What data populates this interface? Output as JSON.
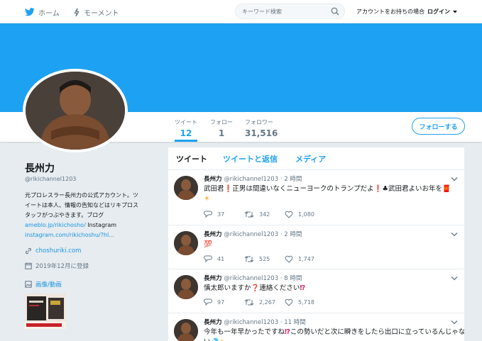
{
  "nav": {
    "home": "ホーム",
    "moments": "モーメント",
    "search_placeholder": "キーワード検索",
    "login_prompt": "アカウントをお持ちの場合",
    "login": "ログイン"
  },
  "colors": {
    "accent": "#1da1f2",
    "banner": "#1da1f2",
    "link": "#1b95e0",
    "background": "#e6ecf0"
  },
  "profile": {
    "name": "長州力",
    "handle": "@rikichannel1203",
    "bio_lines": [
      "元プロレスラー長州力の公式アカウント。ツ",
      "イートは本人、情報の告知などはリキプロス",
      "タッフがつぶやきます。ブログ"
    ],
    "blog_link": "ameblo.jp/rikichosho/",
    "instagram_label": " Instagram",
    "instagram_link": "instagram.com/rikichoshu/?hl...",
    "website": "choshuriki.com",
    "joined": "2019年12月に登録",
    "media_label": "画像/動画"
  },
  "stats": [
    {
      "label": "ツイート",
      "value": "12"
    },
    {
      "label": "フォロー",
      "value": "1"
    },
    {
      "label": "フォロワー",
      "value": "31,516"
    }
  ],
  "follow_button": "フォローする",
  "timeline": {
    "tabs": [
      "ツイート",
      "ツイートと返信",
      "メディア"
    ],
    "tweets": [
      {
        "name": "長州力",
        "handle": "@rikichannel1203",
        "time": "· 2 時間",
        "text_parts": [
          "武田君",
          "❗",
          "正男は間違いなくニューヨークのトランプだよ",
          "❗",
          "♣",
          "武田君よいお年を",
          "🧧",
          "☀"
        ],
        "replies": "37",
        "retweets": "342",
        "likes": "1,080"
      },
      {
        "name": "長州力",
        "handle": "@rikichannel1203",
        "time": "· 2 時間",
        "text": "💯",
        "replies": "41",
        "retweets": "525",
        "likes": "1,747"
      },
      {
        "name": "長州力",
        "handle": "@rikichannel1203",
        "time": "· 8 時間",
        "text_parts": [
          "慎太郎いますか",
          "❓",
          "連絡ください",
          "⁉"
        ],
        "replies": "97",
        "retweets": "2,267",
        "likes": "5,718"
      },
      {
        "name": "長州力",
        "handle": "@rikichannel1203",
        "time": "· 11 時間",
        "text_parts": [
          "今年も一年早かったですね",
          "⁉",
          "この勢いだと次に瞬きをしたら出口に立っているんじゃな",
          "い",
          "💦",
          "☀"
        ]
      }
    ]
  }
}
